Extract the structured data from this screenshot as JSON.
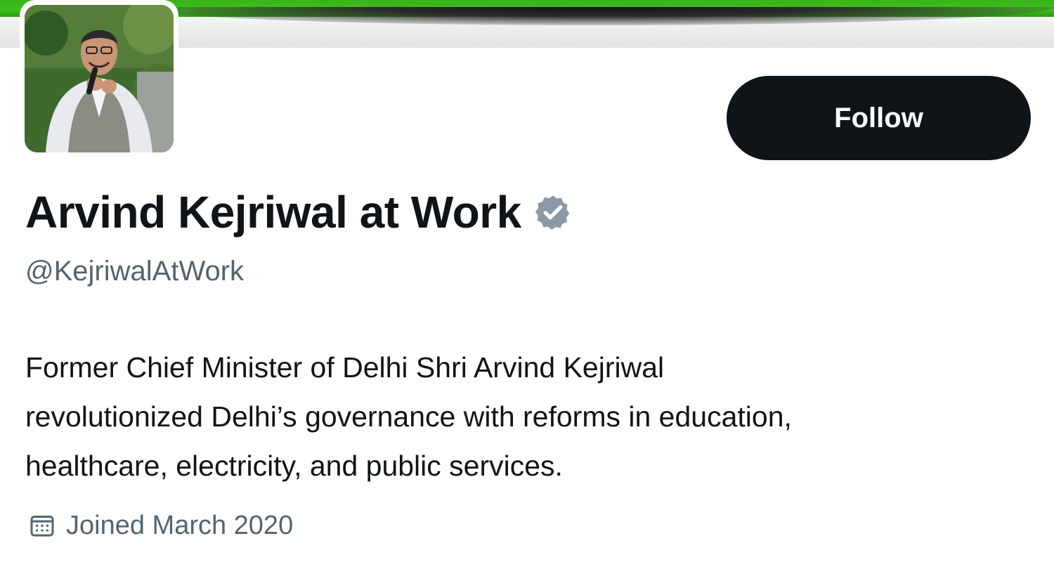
{
  "profile": {
    "display_name": "Arvind Kejriwal at Work",
    "handle": "@KejriwalAtWork",
    "verified": true,
    "bio_lines": [
      "Former Chief Minister of Delhi Shri Arvind Kejriwal",
      "revolutionized Delhi’s governance with reforms in education,",
      "healthcare, electricity, and public services."
    ],
    "joined": "Joined March 2020"
  },
  "actions": {
    "follow_label": "Follow"
  },
  "icons": {
    "badge": "verified-badge-icon",
    "calendar": "calendar-icon"
  },
  "colors": {
    "banner_green": "#3fbe1d",
    "follow_button_bg": "#0f1419",
    "primary_text": "#0f1419",
    "secondary_text": "#536471",
    "verified_badge": "#8b98a5"
  }
}
